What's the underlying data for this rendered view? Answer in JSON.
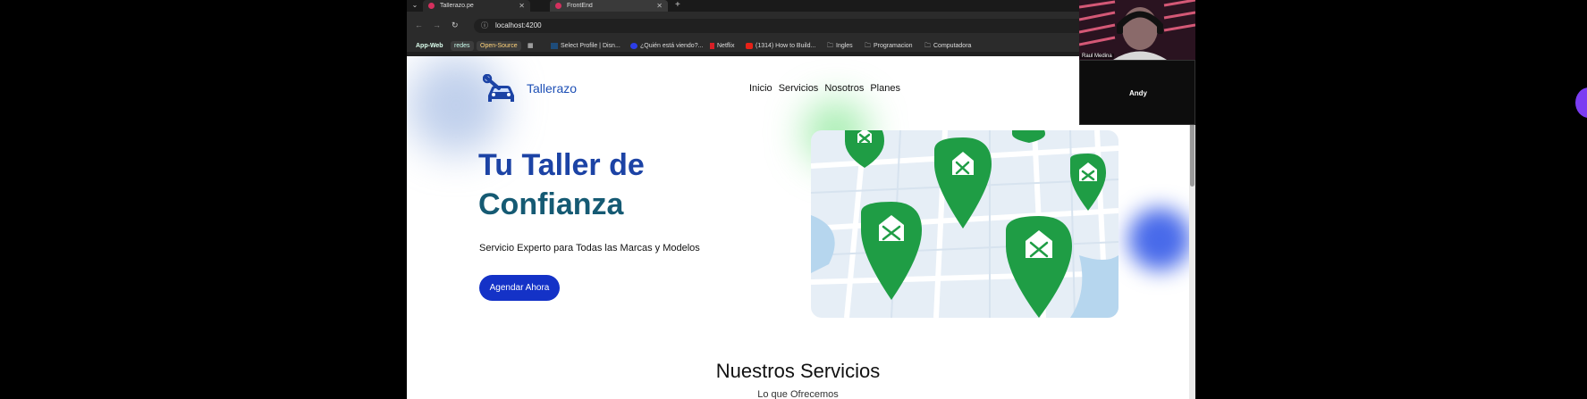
{
  "browser": {
    "tabs": [
      {
        "label": "Tallerazo.pe",
        "active": true
      },
      {
        "label": "FrontEnd",
        "active": false
      }
    ],
    "url": "localhost:4200",
    "bookmarks": [
      {
        "label": "App-Web",
        "style": "pill"
      },
      {
        "label": "redes",
        "style": "pill"
      },
      {
        "label": "Open-Source",
        "style": "pill"
      },
      {
        "label": "Select Profile | Disn...",
        "style": "plain"
      },
      {
        "label": "¿Quién está viendo?...",
        "style": "plain"
      },
      {
        "label": "Netflix",
        "style": "plain"
      },
      {
        "label": "(1314) How to Build...",
        "style": "plain"
      },
      {
        "label": "Ingles",
        "style": "folder"
      },
      {
        "label": "Programacion",
        "style": "folder"
      },
      {
        "label": "Computadora",
        "style": "folder"
      }
    ]
  },
  "site": {
    "brand": "Tallerazo",
    "nav": [
      "Inicio",
      "Servicios",
      "Nosotros",
      "Planes"
    ],
    "hero": {
      "title_line1": "Tu Taller de",
      "title_line2": "Confianza",
      "subtitle": "Servicio Experto para Todas las Marcas y Modelos",
      "cta": "Agendar Ahora"
    },
    "services": {
      "title": "Nuestros Servicios",
      "subtitle": "Lo que Ofrecemos"
    }
  },
  "video_call": {
    "participant1": "Raul Medina",
    "participant2": "Andy"
  },
  "colors": {
    "brand_blue": "#1c43a5",
    "cta_blue": "#1432c7",
    "pin_green": "#1f9d45"
  }
}
